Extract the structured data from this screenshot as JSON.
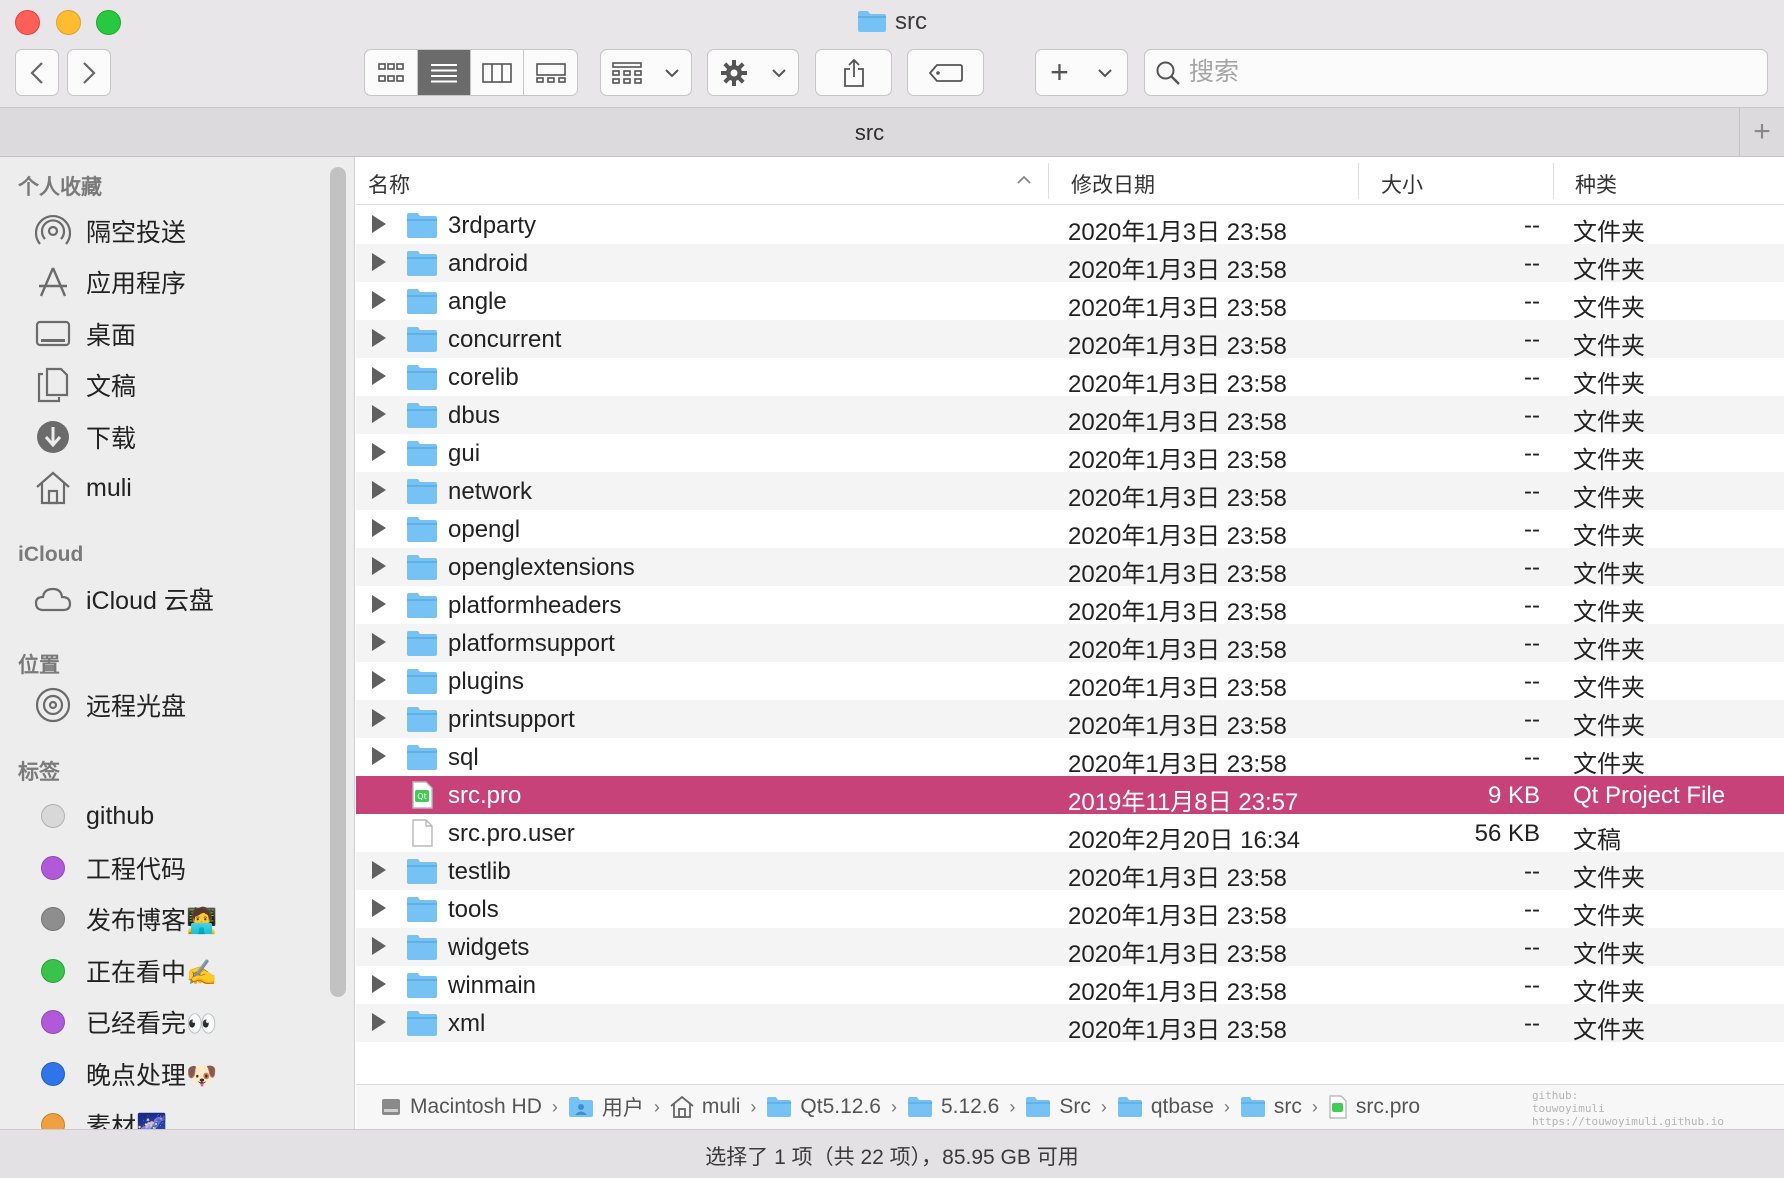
{
  "window": {
    "title": "src"
  },
  "toolbar": {
    "search_placeholder": "搜索",
    "add_label": "+"
  },
  "tabbar": {
    "tab_label": "src",
    "add_label": "+"
  },
  "sidebar": {
    "favorites_header": "个人收藏",
    "favorites": [
      {
        "label": "隔空投送",
        "icon": "airdrop-icon"
      },
      {
        "label": "应用程序",
        "icon": "applications-icon"
      },
      {
        "label": "桌面",
        "icon": "desktop-icon"
      },
      {
        "label": "文稿",
        "icon": "documents-icon"
      },
      {
        "label": "下载",
        "icon": "downloads-icon"
      },
      {
        "label": "muli",
        "icon": "home-icon"
      }
    ],
    "icloud_header": "iCloud",
    "icloud": [
      {
        "label": "iCloud 云盘",
        "icon": "cloud-icon"
      }
    ],
    "locations_header": "位置",
    "locations": [
      {
        "label": "远程光盘",
        "icon": "disc-icon"
      }
    ],
    "tags_header": "标签",
    "tags": [
      {
        "label": "github",
        "color": "#d8d8d8"
      },
      {
        "label": "工程代码",
        "color": "#b05ad9"
      },
      {
        "label": "发布博客🧑‍💻",
        "color": "#8e8e8e"
      },
      {
        "label": "正在看中✍️",
        "color": "#3ac34a"
      },
      {
        "label": "已经看完👀",
        "color": "#b05ad9"
      },
      {
        "label": "晚点处理🐶",
        "color": "#2f74e8"
      },
      {
        "label": "素材🌌",
        "color": "#f0a040"
      }
    ]
  },
  "columns": {
    "name": "名称",
    "date": "修改日期",
    "size": "大小",
    "kind": "种类"
  },
  "files": [
    {
      "name": "3rdparty",
      "date": "2020年1月3日 23:58",
      "size": "--",
      "kind": "文件夹",
      "type": "folder"
    },
    {
      "name": "android",
      "date": "2020年1月3日 23:58",
      "size": "--",
      "kind": "文件夹",
      "type": "folder"
    },
    {
      "name": "angle",
      "date": "2020年1月3日 23:58",
      "size": "--",
      "kind": "文件夹",
      "type": "folder"
    },
    {
      "name": "concurrent",
      "date": "2020年1月3日 23:58",
      "size": "--",
      "kind": "文件夹",
      "type": "folder"
    },
    {
      "name": "corelib",
      "date": "2020年1月3日 23:58",
      "size": "--",
      "kind": "文件夹",
      "type": "folder"
    },
    {
      "name": "dbus",
      "date": "2020年1月3日 23:58",
      "size": "--",
      "kind": "文件夹",
      "type": "folder"
    },
    {
      "name": "gui",
      "date": "2020年1月3日 23:58",
      "size": "--",
      "kind": "文件夹",
      "type": "folder"
    },
    {
      "name": "network",
      "date": "2020年1月3日 23:58",
      "size": "--",
      "kind": "文件夹",
      "type": "folder"
    },
    {
      "name": "opengl",
      "date": "2020年1月3日 23:58",
      "size": "--",
      "kind": "文件夹",
      "type": "folder"
    },
    {
      "name": "openglextensions",
      "date": "2020年1月3日 23:58",
      "size": "--",
      "kind": "文件夹",
      "type": "folder"
    },
    {
      "name": "platformheaders",
      "date": "2020年1月3日 23:58",
      "size": "--",
      "kind": "文件夹",
      "type": "folder"
    },
    {
      "name": "platformsupport",
      "date": "2020年1月3日 23:58",
      "size": "--",
      "kind": "文件夹",
      "type": "folder"
    },
    {
      "name": "plugins",
      "date": "2020年1月3日 23:58",
      "size": "--",
      "kind": "文件夹",
      "type": "folder"
    },
    {
      "name": "printsupport",
      "date": "2020年1月3日 23:58",
      "size": "--",
      "kind": "文件夹",
      "type": "folder"
    },
    {
      "name": "sql",
      "date": "2020年1月3日 23:58",
      "size": "--",
      "kind": "文件夹",
      "type": "folder"
    },
    {
      "name": "src.pro",
      "date": "2019年11月8日 23:57",
      "size": "9 KB",
      "kind": "Qt Project File",
      "type": "qt",
      "selected": true
    },
    {
      "name": "src.pro.user",
      "date": "2020年2月20日 16:34",
      "size": "56 KB",
      "kind": "文稿",
      "type": "doc"
    },
    {
      "name": "testlib",
      "date": "2020年1月3日 23:58",
      "size": "--",
      "kind": "文件夹",
      "type": "folder"
    },
    {
      "name": "tools",
      "date": "2020年1月3日 23:58",
      "size": "--",
      "kind": "文件夹",
      "type": "folder"
    },
    {
      "name": "widgets",
      "date": "2020年1月3日 23:58",
      "size": "--",
      "kind": "文件夹",
      "type": "folder"
    },
    {
      "name": "winmain",
      "date": "2020年1月3日 23:58",
      "size": "--",
      "kind": "文件夹",
      "type": "folder"
    },
    {
      "name": "xml",
      "date": "2020年1月3日 23:58",
      "size": "--",
      "kind": "文件夹",
      "type": "folder"
    }
  ],
  "pathbar": [
    {
      "label": "Macintosh HD",
      "icon": "disk-icon"
    },
    {
      "label": "用户",
      "icon": "users-folder-icon"
    },
    {
      "label": "muli",
      "icon": "home-icon"
    },
    {
      "label": "Qt5.12.6",
      "icon": "folder-icon"
    },
    {
      "label": "5.12.6",
      "icon": "folder-icon"
    },
    {
      "label": "Src",
      "icon": "folder-icon"
    },
    {
      "label": "qtbase",
      "icon": "folder-icon"
    },
    {
      "label": "src",
      "icon": "folder-icon"
    },
    {
      "label": "src.pro",
      "icon": "qt-file-icon"
    }
  ],
  "watermark": {
    "line1": "github:",
    "line2": "touwoyimuli",
    "line3": "https://touwoyimuli.github.io"
  },
  "status": {
    "text": "选择了 1 项（共 22 项），85.95 GB 可用"
  },
  "colors": {
    "selection": "#c8427a",
    "folder": "#76c2f5"
  }
}
